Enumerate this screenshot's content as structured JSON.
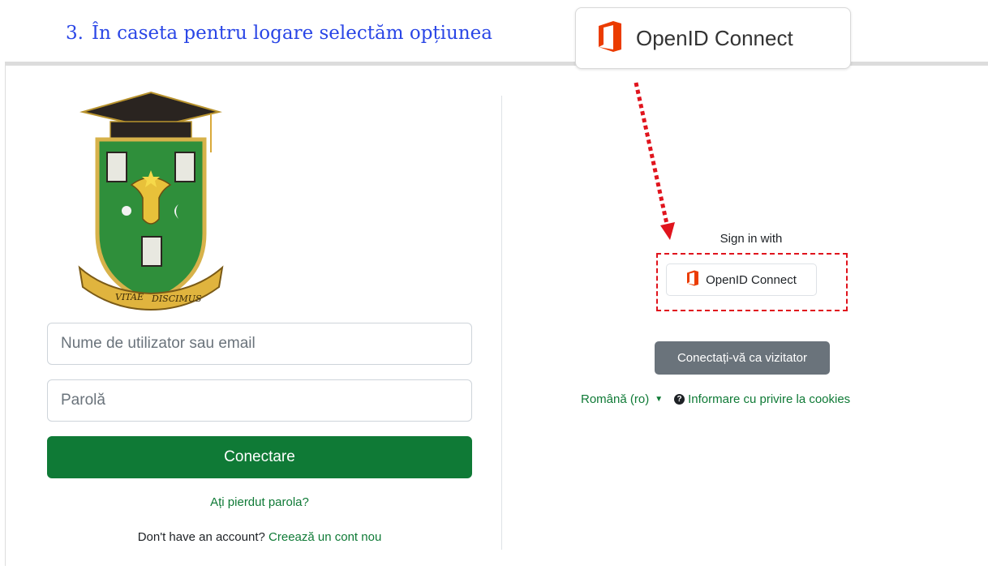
{
  "heading": {
    "number": "3.",
    "text": "În caseta pentru logare selectăm opțiunea"
  },
  "callout": {
    "label": "OpenID Connect",
    "icon": "office-icon"
  },
  "login": {
    "username_placeholder": "Nume de utilizator sau email",
    "username_value": "",
    "password_placeholder": "Parolă",
    "password_value": "",
    "submit_label": "Conectare",
    "forgot_label": "Ați pierdut parola?",
    "signup_prompt": "Don't have an account?",
    "signup_link": "Creează un cont nou"
  },
  "logo": {
    "motto_a": "VITAE",
    "motto_b": "DISCIMUS"
  },
  "sso": {
    "heading": "Sign in with",
    "provider_label": "OpenID Connect",
    "provider_icon": "office-icon",
    "guest_label": "Conectați-vă ca vizitator"
  },
  "footer": {
    "language_label": "Română (ro)",
    "cookies_label": "Informare cu privire la cookies"
  },
  "colors": {
    "accent": "#0f7a36",
    "heading": "#2a46e6",
    "highlight": "#e0141d",
    "office_orange": "#eb3c00",
    "guest_button": "#6a737b"
  }
}
